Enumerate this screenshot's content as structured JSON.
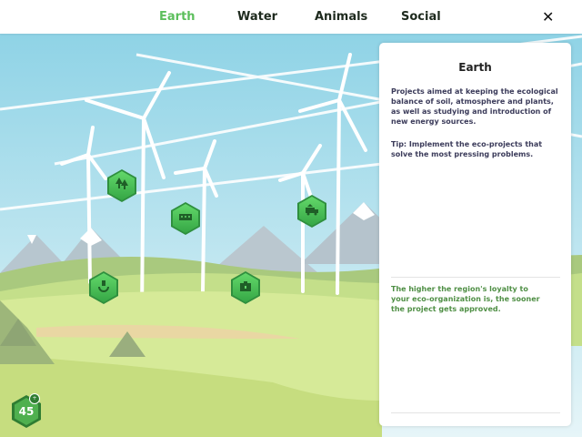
{
  "tabs": [
    {
      "label": "Earth",
      "active": true
    },
    {
      "label": "Water",
      "active": false
    },
    {
      "label": "Animals",
      "active": false
    },
    {
      "label": "Social",
      "active": false
    }
  ],
  "close_label": "✕",
  "panel": {
    "title": "Earth",
    "description": "Projects aimed at keeping the ecological balance of soil, atmosphere and plants, as well as studying and introduction of new energy sources.",
    "tip": "Tip: Implement the eco-projects that solve the most pressing problems.",
    "loyalty_hint": "The higher the region's loyalty to your eco-organization is, the sooner the project gets approved."
  },
  "project_nodes": [
    {
      "icon": "forest-icon"
    },
    {
      "icon": "solar-panel-icon"
    },
    {
      "icon": "recycling-truck-icon"
    },
    {
      "icon": "eco-plug-icon"
    },
    {
      "icon": "eco-toolbox-icon"
    }
  ],
  "loyalty_badge": {
    "value": "45",
    "indicator": "+"
  },
  "colors": {
    "accent": "#5cbf5c",
    "hint_text": "#4f8f45",
    "node_fill": "#35a645"
  }
}
